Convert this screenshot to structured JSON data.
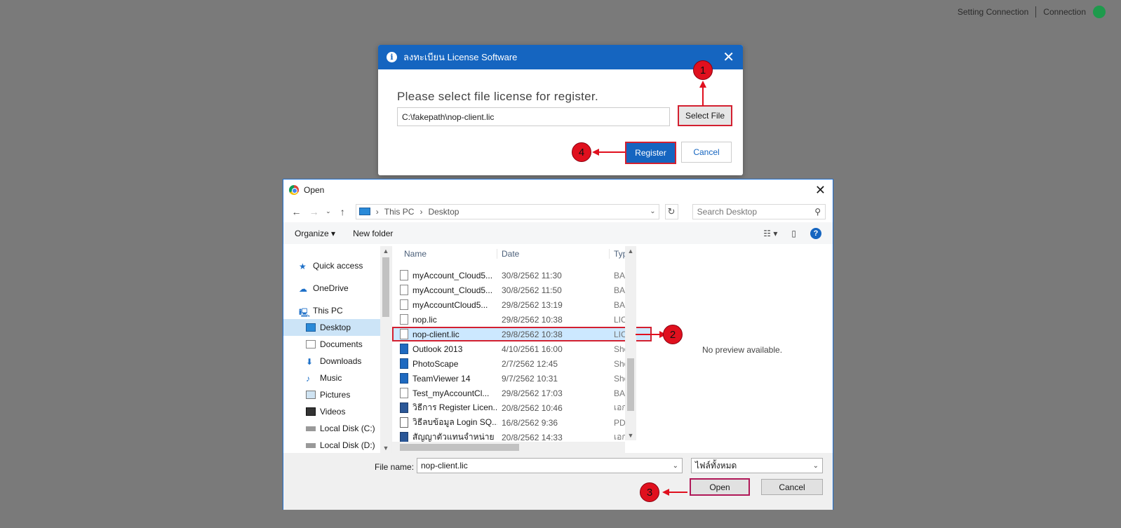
{
  "topbar": {
    "setting": "Setting Connection",
    "connection": "Connection",
    "status_color": "#1e9a4c"
  },
  "modal": {
    "title": "ลงทะเบียน License Software",
    "prompt": "Please select file license for register.",
    "path_value": "C:\\fakepath\\nop-client.lic",
    "select_label": "Select File",
    "register_label": "Register",
    "cancel_label": "Cancel",
    "accent": "#1565c0"
  },
  "annotations": {
    "b1": "1",
    "b2": "2",
    "b3": "3",
    "b4": "4",
    "color": "#e0101e"
  },
  "dialog": {
    "title": "Open",
    "breadcrumb": [
      "This PC",
      "Desktop"
    ],
    "search_placeholder": "Search Desktop",
    "organize": "Organize",
    "new_folder": "New folder",
    "nav": [
      {
        "label": "Quick access",
        "icon": "star-icon"
      },
      {
        "label": "OneDrive",
        "icon": "cloud-icon"
      },
      {
        "label": "This PC",
        "icon": "computer-icon"
      },
      {
        "label": "Desktop",
        "icon": "desktop-icon"
      },
      {
        "label": "Documents",
        "icon": "documents-icon"
      },
      {
        "label": "Downloads",
        "icon": "download-icon"
      },
      {
        "label": "Music",
        "icon": "music-icon"
      },
      {
        "label": "Pictures",
        "icon": "pictures-icon"
      },
      {
        "label": "Videos",
        "icon": "videos-icon"
      },
      {
        "label": "Local Disk (C:)",
        "icon": "disk-icon"
      },
      {
        "label": "Local Disk (D:)",
        "icon": "disk-icon"
      }
    ],
    "columns": {
      "name": "Name",
      "date": "Date",
      "type": "Typ"
    },
    "files": [
      {
        "name": "myAccount_Cloud5...",
        "date": "30/8/2562 11:30",
        "type": "BA",
        "icon": "file-icon"
      },
      {
        "name": "myAccount_Cloud5...",
        "date": "30/8/2562 11:50",
        "type": "BA",
        "icon": "file-icon"
      },
      {
        "name": "myAccountCloud5...",
        "date": "29/8/2562 13:19",
        "type": "BA",
        "icon": "file-icon"
      },
      {
        "name": "nop.lic",
        "date": "29/8/2562 10:38",
        "type": "LIC",
        "icon": "file-icon"
      },
      {
        "name": "nop-client.lic",
        "date": "29/8/2562 10:38",
        "type": "LIC",
        "icon": "file-icon"
      },
      {
        "name": "Outlook 2013",
        "date": "4/10/2561 16:00",
        "type": "Sho",
        "icon": "shortcut-icon"
      },
      {
        "name": "PhotoScape",
        "date": "2/7/2562 12:45",
        "type": "Sho",
        "icon": "shortcut-icon"
      },
      {
        "name": "TeamViewer 14",
        "date": "9/7/2562 10:31",
        "type": "Sho",
        "icon": "shortcut-icon"
      },
      {
        "name": "Test_myAccountCl...",
        "date": "29/8/2562 17:03",
        "type": "BA",
        "icon": "file-icon"
      },
      {
        "name": "วิธีการ Register Licen...",
        "date": "20/8/2562 10:46",
        "type": "เอก",
        "icon": "word-icon"
      },
      {
        "name": "วิธีลบข้อมูล Login SQ...",
        "date": "16/8/2562 9:36",
        "type": "PD",
        "icon": "pdf-icon"
      },
      {
        "name": "สัญญาตัวแทนจำหน่าย ...",
        "date": "20/8/2562 14:33",
        "type": "เอก",
        "icon": "word-icon"
      }
    ],
    "preview_text": "No preview available.",
    "filename_label": "File name:",
    "filename_value": "nop-client.lic",
    "filetype_value": "ไฟล์ทั้งหมด",
    "open_label": "Open",
    "cancel_label": "Cancel"
  }
}
